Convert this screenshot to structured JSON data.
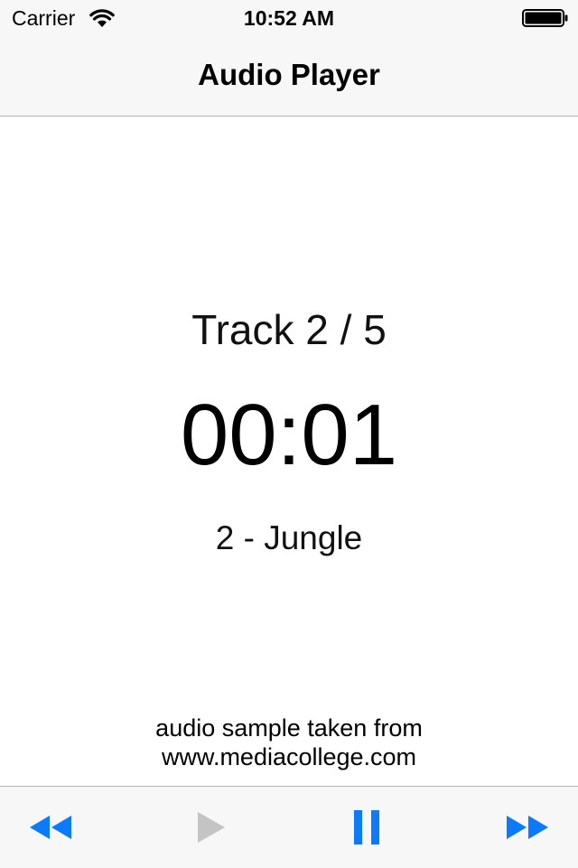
{
  "status_bar": {
    "carrier": "Carrier",
    "time": "10:52 AM",
    "wifi_icon": "wifi-icon",
    "battery_icon": "battery-icon"
  },
  "nav": {
    "title": "Audio Player"
  },
  "player": {
    "track_label": "Track 2 / 5",
    "elapsed": "00:01",
    "song": "2 - Jungle"
  },
  "credit": {
    "line1": "audio sample taken from",
    "line2": "www.mediacollege.com"
  },
  "toolbar": {
    "rewind_icon": "rewind-icon",
    "play_icon": "play-icon",
    "pause_icon": "pause-icon",
    "fast_forward_icon": "fast-forward-icon",
    "play_enabled": false
  },
  "colors": {
    "accent": "#0a7aff",
    "disabled": "#c4c4c4",
    "bar_background": "#f7f7f7",
    "separator": "#b2b2b2"
  }
}
